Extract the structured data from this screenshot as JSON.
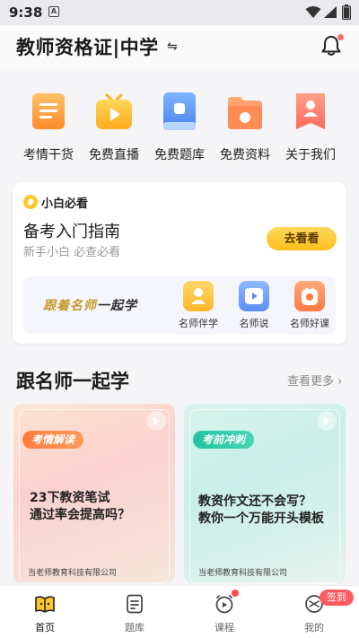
{
  "status_bar": {
    "time": "9:38",
    "notification_icon": "A"
  },
  "header": {
    "title": "教师资格证|中学",
    "switch_symbol": "⇋"
  },
  "quick_links": [
    {
      "label": "考情干货",
      "icon": "news-book-icon"
    },
    {
      "label": "免费直播",
      "icon": "live-tv-icon"
    },
    {
      "label": "免费题库",
      "icon": "question-bank-icon"
    },
    {
      "label": "免费资料",
      "icon": "folder-icon"
    },
    {
      "label": "关于我们",
      "icon": "about-us-icon"
    }
  ],
  "beginner_card": {
    "tag": "小白必看",
    "title": "备考入门指南",
    "subtitle": "新手小白 必查必看",
    "button": "去看看",
    "slogan_highlight": "跟着名师",
    "slogan_rest": "一起学",
    "shortcuts": [
      {
        "label": "名师伴学",
        "icon": "mentor-icon"
      },
      {
        "label": "名师说",
        "icon": "video-play-icon"
      },
      {
        "label": "名师好课",
        "icon": "good-course-icon"
      }
    ]
  },
  "section": {
    "title": "跟名师一起学",
    "more": "查看更多 ›"
  },
  "courses": [
    {
      "badge": "考情解读",
      "title": "23下教资笔试\n通过率会提高吗？",
      "org": "当老师教育科技有限公司"
    },
    {
      "badge": "考前冲刺",
      "title": "教资作文还不会写？\n教你一个万能开头模板",
      "org": "当老师教育科技有限公司"
    }
  ],
  "tabs": [
    {
      "label": "首页",
      "icon": "home-book-icon",
      "active": true
    },
    {
      "label": "题库",
      "icon": "question-bank-tab-icon"
    },
    {
      "label": "课程",
      "icon": "course-clock-icon"
    },
    {
      "label": "我的",
      "icon": "profile-icon",
      "badge": "签到"
    }
  ],
  "colors": {
    "accent_yellow": "#ffc629",
    "brand_orange": "#ff7a3c",
    "brand_teal": "#22c3a0",
    "badge_red": "#ff5a5f"
  }
}
